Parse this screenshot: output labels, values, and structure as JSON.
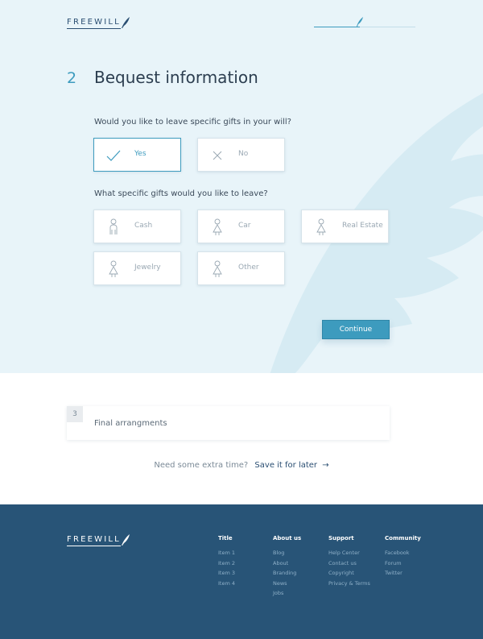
{
  "brand": {
    "name": "FREEWILL"
  },
  "progress": {
    "fraction": 0.45
  },
  "step": {
    "number": "2",
    "title": "Bequest information"
  },
  "question1": {
    "text": "Would you like to leave specific gifts in your will?",
    "options": [
      {
        "label": "Yes",
        "icon": "check-icon",
        "selected": true
      },
      {
        "label": "No",
        "icon": "x-icon",
        "selected": false
      }
    ]
  },
  "question2": {
    "text": "What specific gifts would you like to leave?",
    "options": [
      {
        "label": "Cash",
        "icon": "person-icon"
      },
      {
        "label": "Car",
        "icon": "person-icon"
      },
      {
        "label": "Real Estate",
        "icon": "person-icon"
      },
      {
        "label": "Jewelry",
        "icon": "person-icon"
      },
      {
        "label": "Other",
        "icon": "person-icon"
      }
    ]
  },
  "continue_label": "Continue",
  "next_step": {
    "number": "3",
    "title": "Final arrangments"
  },
  "save": {
    "prompt": "Need some extra time?",
    "link": "Save it for later",
    "arrow": "→"
  },
  "footer": {
    "columns": [
      {
        "title": "Title",
        "items": [
          "Item 1",
          "Item 2",
          "Item 3",
          "Item 4"
        ]
      },
      {
        "title": "About us",
        "items": [
          "Blog",
          "About",
          "Branding",
          "News",
          "Jobs"
        ]
      },
      {
        "title": "Support",
        "items": [
          "Help Center",
          "Contact us",
          "Copyright",
          "Privacy & Terms"
        ]
      },
      {
        "title": "Community",
        "items": [
          "Facebook",
          "Forum",
          "Twitter"
        ]
      }
    ]
  },
  "colors": {
    "accent": "#3d9bbe",
    "navy": "#285477",
    "hero_bg": "#e8f4f9"
  }
}
